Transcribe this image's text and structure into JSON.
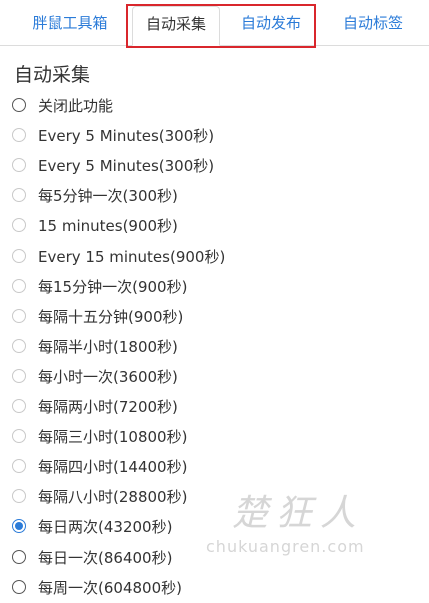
{
  "tabs": [
    {
      "label": "胖鼠工具箱"
    },
    {
      "label": "自动采集"
    },
    {
      "label": "自动发布"
    },
    {
      "label": "自动标签"
    }
  ],
  "section": {
    "title": "自动采集"
  },
  "options": [
    {
      "label": "关闭此功能",
      "checked": false
    },
    {
      "label": "Every 5 Minutes(300秒)",
      "checked": false
    },
    {
      "label": "Every 5 Minutes(300秒)",
      "checked": false
    },
    {
      "label": "每5分钟一次(300秒)",
      "checked": false
    },
    {
      "label": "15 minutes(900秒)",
      "checked": false
    },
    {
      "label": "Every 15 minutes(900秒)",
      "checked": false
    },
    {
      "label": "每15分钟一次(900秒)",
      "checked": false
    },
    {
      "label": "每隔十五分钟(900秒)",
      "checked": false
    },
    {
      "label": "每隔半小时(1800秒)",
      "checked": false
    },
    {
      "label": "每小时一次(3600秒)",
      "checked": false
    },
    {
      "label": "每隔两小时(7200秒)",
      "checked": false
    },
    {
      "label": "每隔三小时(10800秒)",
      "checked": false
    },
    {
      "label": "每隔四小时(14400秒)",
      "checked": false
    },
    {
      "label": "每隔八小时(28800秒)",
      "checked": false
    },
    {
      "label": "每日两次(43200秒)",
      "checked": true
    },
    {
      "label": "每日一次(86400秒)",
      "checked": false
    },
    {
      "label": "每周一次(604800秒)",
      "checked": false
    }
  ],
  "watermark": {
    "logo": "楚狂人",
    "text": "chukuangren.com"
  },
  "colors": {
    "accent": "#2b7bd8",
    "highlight": "#d9262c"
  }
}
